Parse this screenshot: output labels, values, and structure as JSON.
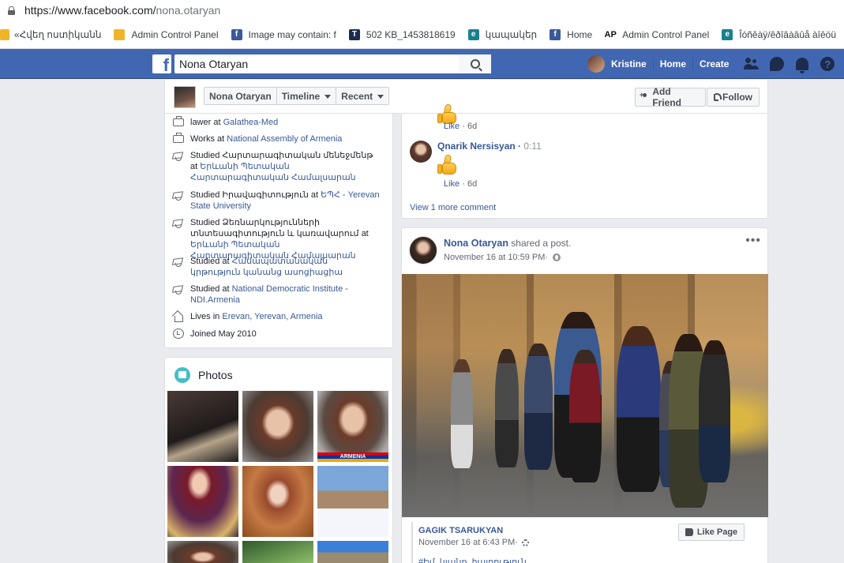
{
  "browser": {
    "url_host": "https://www.facebook.com/",
    "url_path": "nona.otaryan",
    "bookmarks": [
      {
        "label": "«Հվեղ ոստիկանն",
        "icon": "orange-logo-icon"
      },
      {
        "label": "Admin Control Panel",
        "icon": "orange-logo-icon"
      },
      {
        "label": "Image may contain: f",
        "icon": "facebook-icon"
      },
      {
        "label": "502 KB_1453818619",
        "icon": "t-logo-icon"
      },
      {
        "label": "կապակեր",
        "icon": "e-logo-icon"
      },
      {
        "label": "Home",
        "icon": "facebook-icon"
      },
      {
        "label": "Admin Control Panel",
        "icon": "ap-logo-icon"
      },
      {
        "label": "Îóñêàÿ/êðîâàâûå àîêöü",
        "icon": "e-logo-icon"
      }
    ]
  },
  "topbar": {
    "logo": "f",
    "search_value": "Nona Otaryan",
    "user_name": "Kristine",
    "home": "Home",
    "create": "Create",
    "color": "#4267b2"
  },
  "profile": {
    "name": "Nona Otaryan",
    "timeline": "Timeline",
    "recent": "Recent",
    "add_friend": "Add Friend",
    "follow": "Follow"
  },
  "intro": {
    "rows": [
      {
        "icon": "work-icon",
        "prefix": "lawer at ",
        "link": "Galathea-Med"
      },
      {
        "icon": "work-icon",
        "prefix": "Works at ",
        "link": "National Assembly of Armenia"
      },
      {
        "icon": "education-icon",
        "prefix": "Studied Հարտարագիտական մենեջմենթ at ",
        "link": "Երևանի Պետական Հարտարագիտական Համալսարան"
      },
      {
        "icon": "education-icon",
        "prefix": "Studied Իրավագիտություն at ",
        "link": "ԵՊՀ - Yerevan State University"
      },
      {
        "icon": "education-icon",
        "prefix": "Studied Ձեռնարկությունների տնտեսագիտություն և կառավարում at ",
        "link": "Երևանի Պետական Հարտարագիտական Համալսարան"
      },
      {
        "icon": "education-icon",
        "prefix": "Studied at ",
        "link": "Համապատանական կրթություն կանանց ասոցիացիա"
      },
      {
        "icon": "education-icon",
        "prefix": "Studied at ",
        "link": "National Democratic Institute - NDI.Armenia"
      },
      {
        "icon": "home-icon",
        "prefix": "Lives in ",
        "link": "Erevan, Yerevan, Armenia"
      },
      {
        "icon": "clock-icon",
        "prefix": "Joined May 2010",
        "link": ""
      }
    ]
  },
  "photos": {
    "title": "Photos",
    "flag_text": "ARMENIA"
  },
  "comments": {
    "first": {
      "like": "Like",
      "age": "6d"
    },
    "second": {
      "author": "Qnarik Nersisyan",
      "time": "0:11",
      "like": "Like",
      "age": "6d"
    },
    "view_more": "View 1 more comment"
  },
  "post": {
    "author": "Nona Otaryan",
    "action": " shared a post.",
    "date": "November 16 at 10:59 PM",
    "dot": " · ",
    "more": "•••",
    "shared_author": "GAGIK TSARUKYAN",
    "shared_date": "November 16 at 6:43 PM",
    "like_page": "Like Page",
    "shared_text": "#Իմ_կյանք_հայրություն"
  }
}
